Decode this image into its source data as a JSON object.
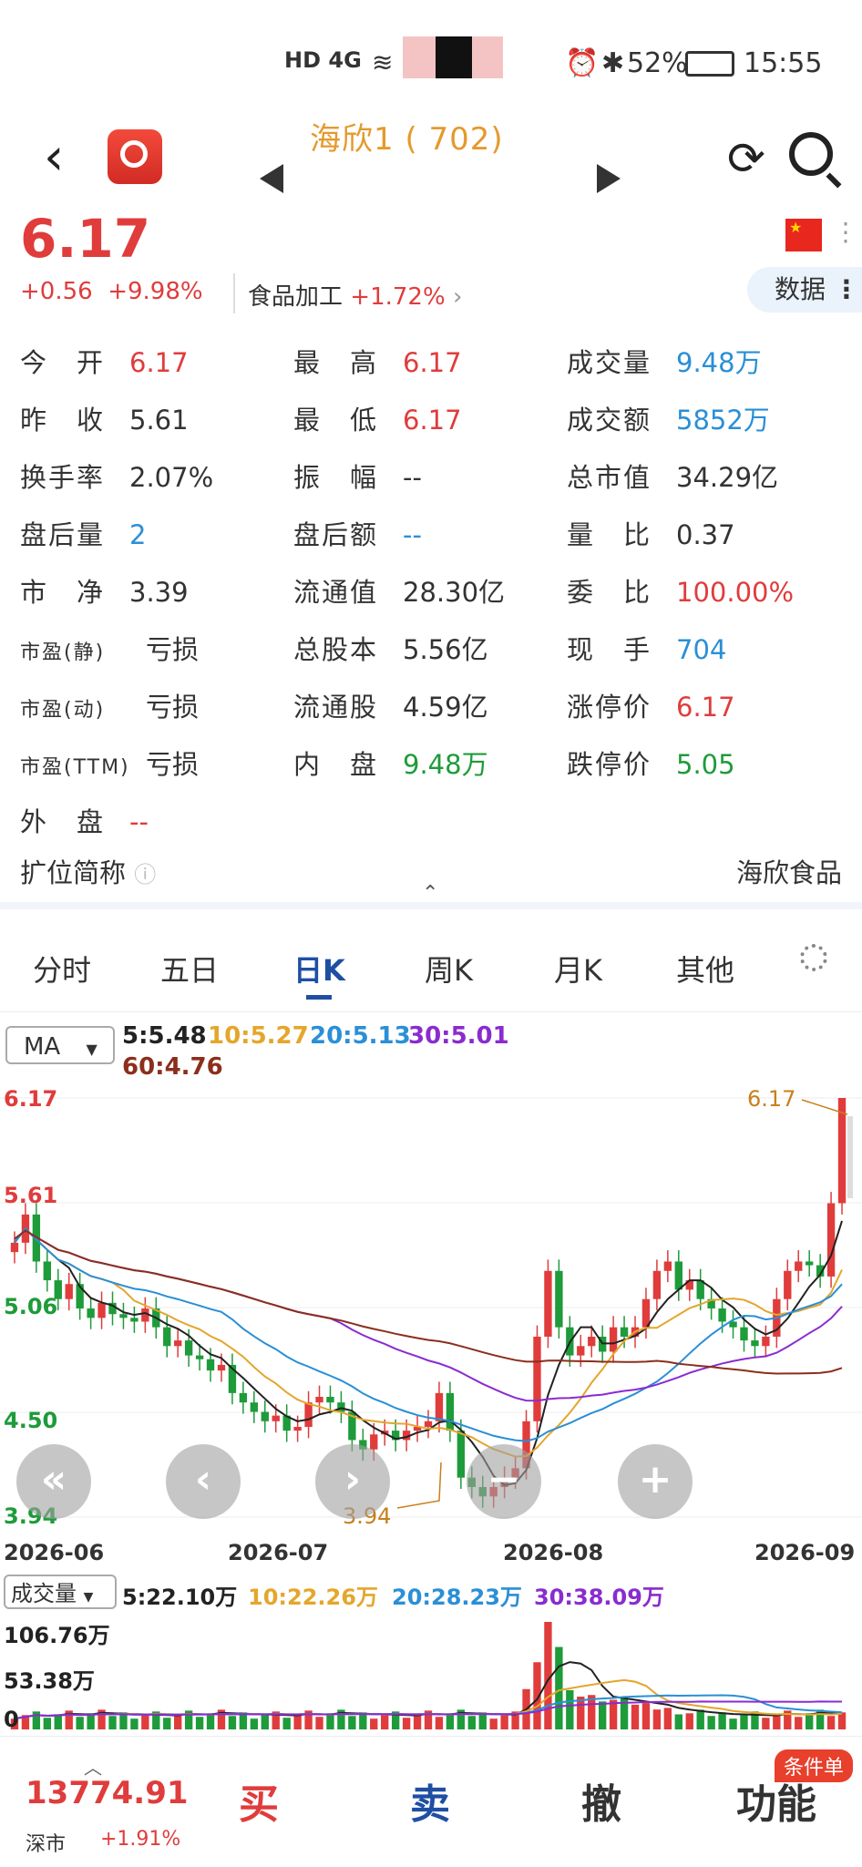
{
  "status_bar": {
    "network": "HD 4G",
    "battery": "52%",
    "time": "15:55"
  },
  "header": {
    "title": "海欣1 (  702)",
    "back_icon": "back-arrow-icon",
    "refresh_icon": "refresh-icon",
    "search_icon": "search-icon"
  },
  "quote": {
    "price": "6.17",
    "change": "+0.56",
    "change_pct": "+9.98%",
    "sector_name": "食品加工",
    "sector_pct": "+1.72%",
    "data_button": "数据"
  },
  "stats": [
    [
      {
        "label": "今　开",
        "value": "6.17",
        "color": "red"
      },
      {
        "label": "最　高",
        "value": "6.17",
        "color": "red"
      },
      {
        "label": "成交量",
        "value": "9.48万",
        "color": "blue"
      }
    ],
    [
      {
        "label": "昨　收",
        "value": "5.61",
        "color": "dark"
      },
      {
        "label": "最　低",
        "value": "6.17",
        "color": "red"
      },
      {
        "label": "成交额",
        "value": "5852万",
        "color": "blue"
      }
    ],
    [
      {
        "label": "换手率",
        "value": "2.07%",
        "color": "dark"
      },
      {
        "label": "振　幅",
        "value": "--",
        "color": "dark"
      },
      {
        "label": "总市值",
        "value": "34.29亿",
        "color": "dark"
      }
    ],
    [
      {
        "label": "盘后量",
        "value": "2",
        "color": "blue"
      },
      {
        "label": "盘后额",
        "value": "--",
        "color": "blue"
      },
      {
        "label": "量　比",
        "value": "0.37",
        "color": "dark"
      }
    ],
    [
      {
        "label": "市　净",
        "value": "3.39",
        "color": "dark"
      },
      {
        "label": "流通值",
        "value": "28.30亿",
        "color": "dark"
      },
      {
        "label": "委　比",
        "value": "100.00%",
        "color": "red"
      }
    ],
    [
      {
        "label": "市盈(静)",
        "value": "亏损",
        "color": "dark"
      },
      {
        "label": "总股本",
        "value": "5.56亿",
        "color": "dark"
      },
      {
        "label": "现　手",
        "value": "704",
        "color": "blue"
      }
    ],
    [
      {
        "label": "市盈(动)",
        "value": "亏损",
        "color": "dark"
      },
      {
        "label": "流通股",
        "value": "4.59亿",
        "color": "dark"
      },
      {
        "label": "涨停价",
        "value": "6.17",
        "color": "red"
      }
    ],
    [
      {
        "label": "市盈(TTM)",
        "value": "亏损",
        "color": "dark"
      },
      {
        "label": "内　盘",
        "value": "9.48万",
        "color": "green"
      },
      {
        "label": "跌停价",
        "value": "5.05",
        "color": "green"
      }
    ],
    [
      {
        "label": "外　盘",
        "value": "--",
        "color": "red"
      }
    ]
  ],
  "short_name": {
    "label": "扩位简称",
    "value": "海欣食品"
  },
  "tabs": [
    "分时",
    "五日",
    "日K",
    "周K",
    "月K",
    "其他"
  ],
  "active_tab": "日K",
  "ma": {
    "selector": "MA",
    "ma5": "5:5.48",
    "ma10": "10:5.27",
    "ma20": "20:5.13",
    "ma30": "30:5.01",
    "ma60": "60:4.76"
  },
  "chart_data": {
    "type": "candlestick",
    "y_ticks": [
      "6.17",
      "5.61",
      "5.06",
      "4.50",
      "3.94"
    ],
    "x_ticks": [
      "2026-06",
      "2026-07",
      "2026-08",
      "2026-09"
    ],
    "ylim": [
      3.94,
      6.17
    ],
    "high_marker": "6.17",
    "low_marker": "3.94",
    "closes": [
      5.4,
      5.55,
      5.3,
      5.2,
      5.1,
      5.18,
      5.05,
      5.0,
      5.08,
      5.02,
      5.0,
      4.98,
      5.05,
      4.95,
      4.85,
      4.88,
      4.8,
      4.78,
      4.72,
      4.75,
      4.6,
      4.55,
      4.5,
      4.45,
      4.48,
      4.4,
      4.42,
      4.55,
      4.58,
      4.55,
      4.5,
      4.35,
      4.3,
      4.38,
      4.4,
      4.35,
      4.4,
      4.42,
      4.45,
      4.6,
      4.4,
      4.15,
      4.1,
      4.05,
      4.1,
      4.15,
      4.2,
      4.45,
      4.9,
      5.25,
      4.95,
      4.8,
      4.85,
      4.9,
      4.82,
      4.95,
      4.9,
      4.95,
      5.1,
      5.25,
      5.3,
      5.15,
      5.2,
      5.1,
      5.05,
      4.98,
      4.95,
      4.88,
      4.85,
      4.9,
      5.1,
      5.25,
      5.3,
      5.28,
      5.22,
      5.61,
      6.17
    ]
  },
  "volume": {
    "selector": "成交量",
    "ma5": "5:22.10万",
    "ma10": "10:22.26万",
    "ma20": "20:28.23万",
    "ma30": "30:38.09万",
    "y_ticks": [
      "106.76万",
      "53.38万",
      "0"
    ]
  },
  "bottom": {
    "index_value": "13774.91",
    "index_name": "深市",
    "index_change": "+1.91%",
    "buy": "买",
    "sell": "卖",
    "cancel": "撤",
    "function": "功能",
    "badge": "条件单"
  }
}
